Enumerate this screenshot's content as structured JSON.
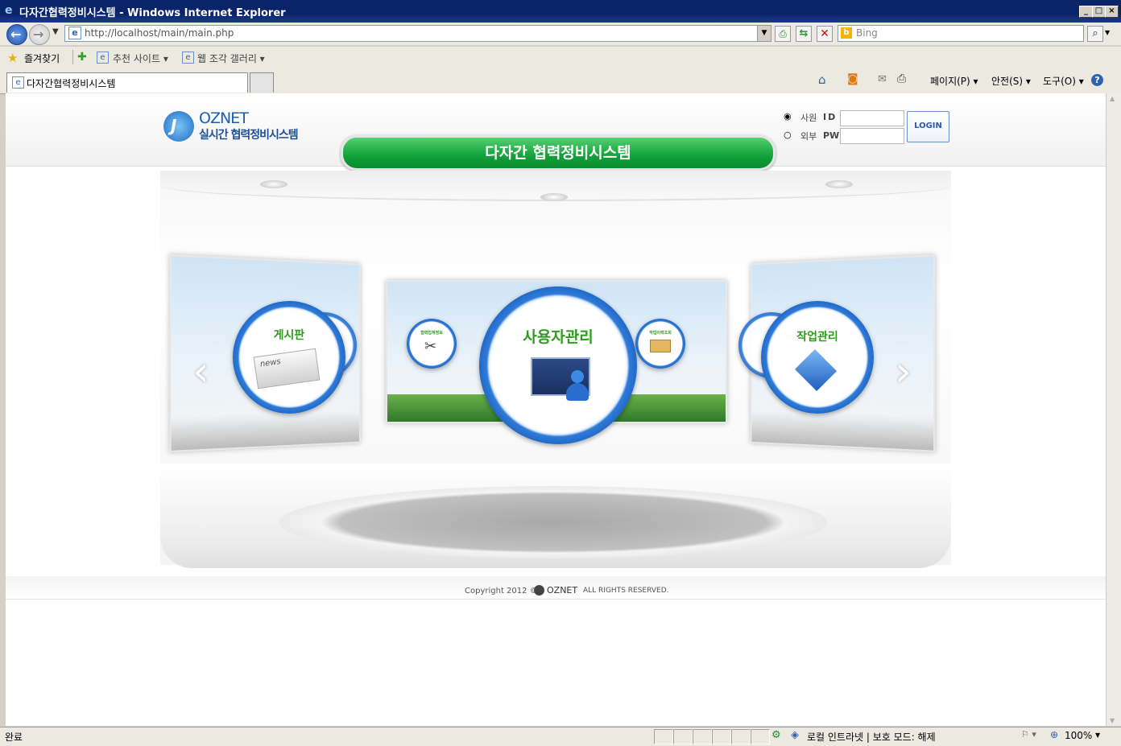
{
  "window": {
    "title": "다자간협력정비시스템 - Windows Internet Explorer"
  },
  "navbar": {
    "address": "http://localhost/main/main.php",
    "search_placeholder": "Bing"
  },
  "favorites": {
    "label": "즐겨찾기",
    "items": [
      "추천 사이트 ▾",
      "웹 조각 갤러리 ▾"
    ]
  },
  "tab": {
    "label": "다자간협력정비시스템"
  },
  "commands": {
    "page": "페이지(P) ▾",
    "safety": "안전(S) ▾",
    "tools": "도구(O) ▾"
  },
  "site": {
    "logo_brand": "OZNET",
    "logo_sub": "실시간 협력정비시스템",
    "banner": "다자간 협력정비시스템",
    "login": {
      "radio_employee": "사원",
      "radio_external": "외부",
      "id_label": "ID",
      "pw_label": "PW",
      "button": "LOGIN"
    },
    "menu": {
      "board": "게시판",
      "user_mgmt": "사용자관리",
      "work_mgmt": "작업관리",
      "small_left": "협력업체정보",
      "small_right": "작업이력조회",
      "news_text": "news"
    },
    "footer": {
      "copyright": "Copyright 2012 ©",
      "brand": "OZNET",
      "rights": "ALL RIGHTS RESERVED."
    }
  },
  "status": {
    "left": "완료",
    "zone": "로컬 인트라넷 | 보호 모드: 해제",
    "zoom": "100%"
  }
}
